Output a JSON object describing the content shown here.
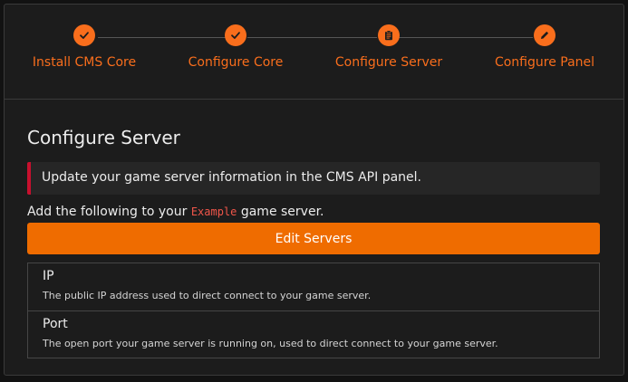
{
  "stepper": {
    "steps": [
      {
        "label": "Install CMS Core",
        "state": "complete",
        "icon": "check-icon"
      },
      {
        "label": "Configure Core",
        "state": "complete",
        "icon": "check-icon"
      },
      {
        "label": "Configure Server",
        "state": "current",
        "icon": "clipboard-icon"
      },
      {
        "label": "Configure Panel",
        "state": "pending",
        "icon": "pencil-icon"
      }
    ],
    "accent_color": "#f96e1c"
  },
  "main": {
    "title": "Configure Server",
    "alert": {
      "text": "Update your game server information in the CMS API panel.",
      "border_color": "#c8102e"
    },
    "intro": {
      "before": "Add the following to your",
      "code": "Example",
      "after": "game server."
    },
    "edit_button_label": "Edit Servers",
    "button_color": "#ef6c00",
    "fields": [
      {
        "name": "IP",
        "description": "The public IP address used to direct connect to your game server."
      },
      {
        "name": "Port",
        "description": "The open port your game server is running on, used to direct connect to your game server."
      }
    ]
  }
}
